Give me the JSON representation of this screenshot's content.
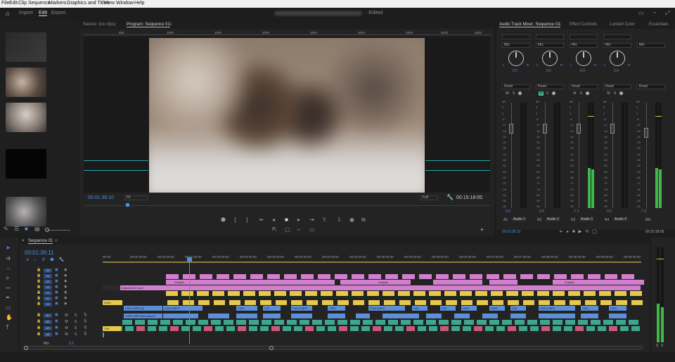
{
  "menu": [
    "File",
    "Edit",
    "Clip",
    "Sequence",
    "Markers",
    "Graphics and Titles",
    "View",
    "Window",
    "Help"
  ],
  "header": {
    "tabs": [
      "Import",
      "Edit",
      "Export"
    ],
    "active": "Edit",
    "status": "- Edited"
  },
  "source_monitor": {
    "tab": "Source: (no clips)"
  },
  "program_monitor": {
    "tab": "Program: Sequence 01",
    "timecode": "00:01:36:10",
    "fit": "Fit",
    "quality": "Full",
    "duration": "00:15:18:05",
    "ruler": [
      "500",
      "1000",
      "1500",
      "2000",
      "2500",
      "3000",
      "3500",
      "4000",
      "4500"
    ]
  },
  "mixer": {
    "tabs": [
      "Audio Track Mixer: Sequence 01",
      "Effect Controls",
      "Lumetri Color",
      "Essentials"
    ],
    "mode_label": "Mix",
    "read_label": "Read",
    "channels": [
      {
        "id": "A1",
        "name": "Audio 1",
        "pan": "0.0",
        "volume": "2.0",
        "level": 0
      },
      {
        "id": "A2",
        "name": "Audio 2",
        "pan": "0.0",
        "volume": "0.0",
        "level": 0
      },
      {
        "id": "A3",
        "name": "Audio 3",
        "pan": "0.0",
        "volume": "-7.2",
        "level": 0.38
      },
      {
        "id": "A4",
        "name": "Audio 4",
        "pan": "0.0",
        "volume": "0.0",
        "level": 0
      },
      {
        "id": "Mix",
        "name": "Mix",
        "pan": "",
        "volume": "-7.2",
        "level": 0.38
      }
    ],
    "db_scale": [
      "dB",
      "6",
      "0",
      "-6",
      "-12",
      "-18",
      "-24",
      "-30",
      "-36",
      "-42",
      "-48",
      "-54",
      "-60",
      "-66",
      "-72",
      "-78",
      "-84",
      "-90",
      "-96"
    ],
    "timecode_left": "00:01:36:10",
    "timecode_right": "00:15:18:05"
  },
  "timeline": {
    "tab": "Sequence 01",
    "timecode": "00:01:36:11",
    "ruler": [
      "00:00",
      "00:00:30:00",
      "00:01:00:00",
      "00:01:30:00",
      "00:02:00:00",
      "00:02:30:00",
      "00:03:00:00",
      "00:03:30:00",
      "00:04:00:00",
      "00:04:30:00",
      "00:05:00:00",
      "00:05:30:00",
      "00:06:00:00",
      "00:06:30:00",
      "00:07:00:00",
      "00:07:30:00",
      "00:08:00:00",
      "00:08:30:00",
      "00:09:00:00",
      "00:09:30:00"
    ],
    "video_tracks": [
      "V5",
      "V4",
      "V3",
      "V2",
      "V1",
      "V1",
      "V2"
    ],
    "audio_tracks": [
      "A1",
      "A2",
      "A3",
      "A4"
    ],
    "mix_label": "Mix",
    "mix_value": "0.0",
    "clip_labels": {
      "graphic": "Graphic",
      "adjustment": "Adjustment Layer",
      "v1a": "C0011.MP4 [V]",
      "v1b": "C0012.MP4",
      "v1c": "C001",
      "v1d": "C00",
      "v1e": "C0013.MP4",
      "v1f": "C0014.MP4",
      "audio_a": "C0011.MP4 Microphone",
      "c00": "C00",
      "index": "Index"
    },
    "meter_labels": [
      "S",
      "S"
    ]
  }
}
